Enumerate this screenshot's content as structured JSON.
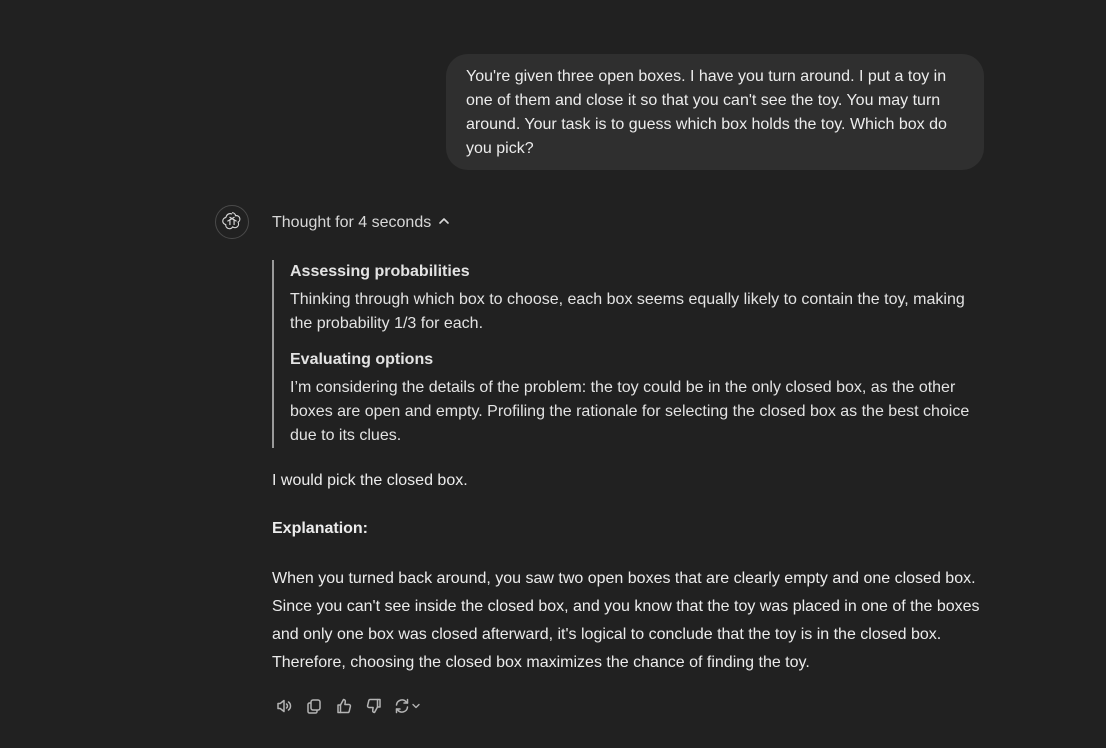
{
  "user_message": {
    "text": "You're given three open boxes. I have you turn around. I put a toy in one of them and close it so that you can't see the toy. You may turn around. Your task is to guess which box holds the toy. Which box do you pick?"
  },
  "assistant": {
    "avatar_icon": "openai-logo-icon",
    "thought_label": "Thought for 4 seconds",
    "thinking_steps": [
      {
        "title": "Assessing probabilities",
        "body": "Thinking through which box to choose, each box seems equally likely to contain the toy, making the probability 1/3 for each."
      },
      {
        "title": "Evaluating options",
        "body": "I’m considering the details of the problem: the toy could be in the only closed box, as the other boxes are open and empty. Profiling the rationale for selecting the closed box as the best choice due to its clues."
      }
    ],
    "answer_line": "I would pick the closed box.",
    "explanation_heading": "Explanation:",
    "explanation_text": "When you turned back around, you saw two open boxes that are clearly empty and one closed box. Since you can't see inside the closed box, and you know that the toy was placed in one of the boxes and only one box was closed afterward, it's logical to conclude that the toy is in the closed box. Therefore, choosing the closed box maximizes the chance of finding the toy."
  },
  "actions": [
    {
      "icon": "read-aloud-icon"
    },
    {
      "icon": "copy-icon"
    },
    {
      "icon": "thumbs-up-icon"
    },
    {
      "icon": "thumbs-down-icon"
    },
    {
      "icon": "regenerate-icon"
    }
  ],
  "colors": {
    "background": "#212121",
    "user_bubble": "#2f2f2f",
    "text": "#ececec",
    "thinking_border": "#9a9a9a"
  }
}
